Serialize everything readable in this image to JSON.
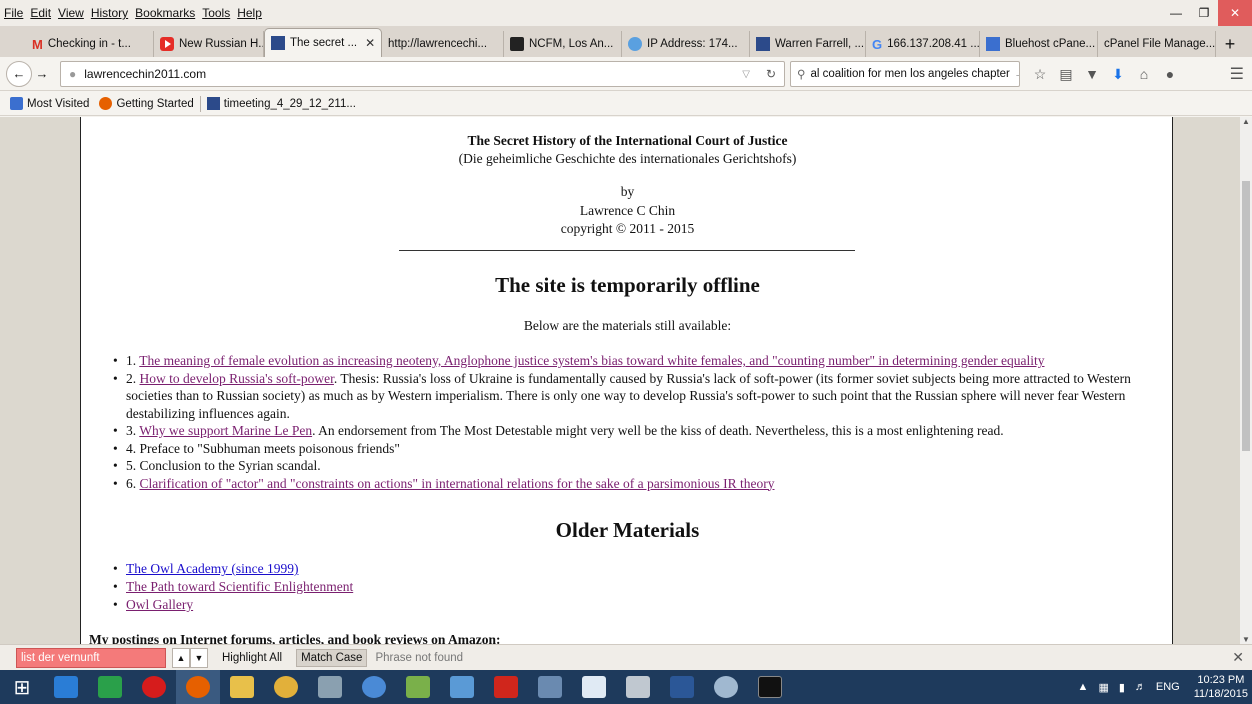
{
  "menu": [
    "File",
    "Edit",
    "View",
    "History",
    "Bookmarks",
    "Tools",
    "Help"
  ],
  "tabs": [
    {
      "label": "Checking in - t...",
      "icon": "gmail-icon",
      "active": false
    },
    {
      "label": "New Russian H...",
      "icon": "youtube-icon",
      "active": false
    },
    {
      "label": "The secret ...",
      "icon": "grid-icon",
      "active": true
    },
    {
      "label": "http://lawrencechi...",
      "icon": "",
      "active": false
    },
    {
      "label": "NCFM, Los An...",
      "icon": "ncfm-icon",
      "active": false
    },
    {
      "label": "IP Address: 174...",
      "icon": "globe-icon",
      "active": false
    },
    {
      "label": "Warren Farrell, ...",
      "icon": "grid-icon",
      "active": false
    },
    {
      "label": "166.137.208.41 ...",
      "icon": "google-icon",
      "active": false
    },
    {
      "label": "Bluehost cPane...",
      "icon": "bluehost-icon",
      "active": false
    },
    {
      "label": "cPanel File Manage...",
      "icon": "",
      "active": false
    }
  ],
  "url": "lawrencechin2011.com",
  "search_value": "al coalition for men los angeles chapter",
  "bookmarks": [
    "Most Visited",
    "Getting Started",
    "timeeting_4_29_12_211..."
  ],
  "page": {
    "title": "The Secret History of the International Court of Justice",
    "subtitle": "(Die geheimliche Geschichte des internationales Gerichtshofs)",
    "by": "by",
    "author": "Lawrence C Chin",
    "copyright": "copyright © 2011 - 2015",
    "offline_heading": "The site is temporarily offline",
    "below": "Below are the materials still available:",
    "items": [
      {
        "num": "1. ",
        "link": "The meaning of female evolution as increasing neoteny, Anglophone justice system's bias toward white females, and \"counting number\" in determining gender equality",
        "text": ""
      },
      {
        "num": "2. ",
        "link": "How to develop Russia's soft-power",
        "text": ". Thesis: Russia's loss of Ukraine is fundamentally caused by Russia's lack of soft-power (its former soviet subjects being more attracted to Western societies than to Russian society) as much as by Western imperialism. There is only one way to develop Russia's soft-power to such point that the Russian sphere will never fear Western destabilizing influences again."
      },
      {
        "num": "3. ",
        "link": "Why we support Marine Le Pen",
        "text": ". An endorsement from The Most Detestable might very well be the kiss of death. Nevertheless, this is a most enlightening read."
      },
      {
        "num": "4. ",
        "link": "",
        "text": "Preface to \"Subhuman meets poisonous friends\""
      },
      {
        "num": "5. ",
        "link": "",
        "text": "Conclusion to the Syrian scandal."
      },
      {
        "num": "6. ",
        "link": "Clarification of \"actor\" and \"constraints on actions\" in international relations for the sake of a parsimonious IR theory",
        "text": ""
      }
    ],
    "older_heading": "Older Materials",
    "older": [
      {
        "label": "The Owl Academy (since 1999)",
        "visited": false
      },
      {
        "label": "The Path toward Scientific Enlightenment",
        "visited": true
      },
      {
        "label": "Owl Gallery",
        "visited": true
      }
    ],
    "postings": "My postings on Internet forums, articles, and book reviews on Amazon:"
  },
  "findbar": {
    "value": "list der vernunft",
    "highlight_all": "Highlight All",
    "match_case": "Match Case",
    "status": "Phrase not found"
  },
  "taskbar": {
    "lang": "ENG",
    "time": "10:23 PM",
    "date": "11/18/2015"
  }
}
